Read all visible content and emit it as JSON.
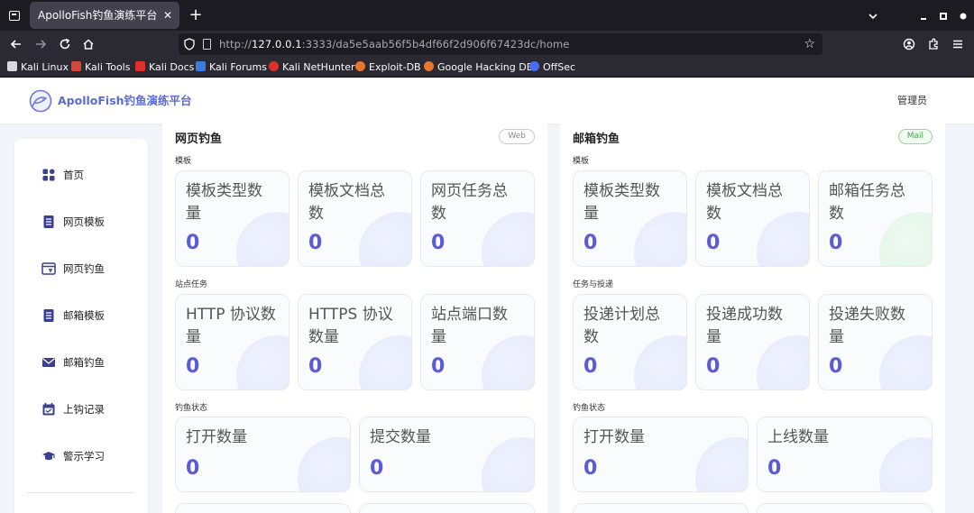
{
  "browser": {
    "tab_title": "ApolloFish钓鱼演练平台",
    "tab_close": "✕",
    "new_tab": "+",
    "url_proto": "http://",
    "url_host": "127.0.0.1",
    "url_path": ":3333/da5e5aab56f5b4df66f2d906f67423dc/home",
    "bookmarks": [
      {
        "label": "Kali Linux",
        "color": "#e8e8ee"
      },
      {
        "label": "Kali Tools",
        "color": "#d6483c"
      },
      {
        "label": "Kali Docs",
        "color": "#e0302d"
      },
      {
        "label": "Kali Forums",
        "color": "#3c7be0"
      },
      {
        "label": "Kali NetHunter",
        "color": "#e0302d"
      },
      {
        "label": "Exploit-DB",
        "color": "#e8772e"
      },
      {
        "label": "Google Hacking DB",
        "color": "#e8772e"
      },
      {
        "label": "OffSec",
        "color": "#4a6cf0"
      }
    ]
  },
  "header": {
    "brand": "ApolloFish钓鱼演练平台",
    "user": "管理员"
  },
  "sidebar": {
    "items": [
      {
        "label": "首页",
        "icon": "dashboard-icon"
      },
      {
        "label": "网页模板",
        "icon": "list-doc-icon"
      },
      {
        "label": "网页钓鱼",
        "icon": "browser-window-icon"
      },
      {
        "label": "邮箱模板",
        "icon": "list-doc-icon"
      },
      {
        "label": "邮箱钓鱼",
        "icon": "envelope-icon"
      },
      {
        "label": "上钩记录",
        "icon": "calendar-icon"
      },
      {
        "label": "警示学习",
        "icon": "graduation-cap-icon"
      }
    ]
  },
  "web_panel": {
    "title": "网页钓鱼",
    "tag": "Web",
    "sections": [
      {
        "label": "模板",
        "cards": [
          {
            "title": "模板类型数量",
            "value": "0"
          },
          {
            "title": "模板文档总数",
            "value": "0"
          },
          {
            "title": "网页任务总数",
            "value": "0"
          }
        ]
      },
      {
        "label": "站点任务",
        "cards": [
          {
            "title": "HTTP 协议数量",
            "value": "0"
          },
          {
            "title": "HTTPS 协议数量",
            "value": "0"
          },
          {
            "title": "站点端口数量",
            "value": "0"
          }
        ]
      },
      {
        "label": "钓鱼状态",
        "cards": [
          {
            "title": "打开数量",
            "value": "0"
          },
          {
            "title": "提交数量",
            "value": "0"
          }
        ]
      }
    ]
  },
  "mail_panel": {
    "title": "邮箱钓鱼",
    "tag": "Mail",
    "sections": [
      {
        "label": "模板",
        "cards": [
          {
            "title": "模板类型数量",
            "value": "0"
          },
          {
            "title": "模板文档总数",
            "value": "0"
          },
          {
            "title": "邮箱任务总数",
            "value": "0"
          }
        ]
      },
      {
        "label": "任务与投递",
        "cards": [
          {
            "title": "投递计划总数",
            "value": "0"
          },
          {
            "title": "投递成功数量",
            "value": "0"
          },
          {
            "title": "投递失败数量",
            "value": "0"
          }
        ]
      },
      {
        "label": "钓鱼状态",
        "cards": [
          {
            "title": "打开数量",
            "value": "0"
          },
          {
            "title": "上线数量",
            "value": "0"
          }
        ]
      }
    ]
  }
}
